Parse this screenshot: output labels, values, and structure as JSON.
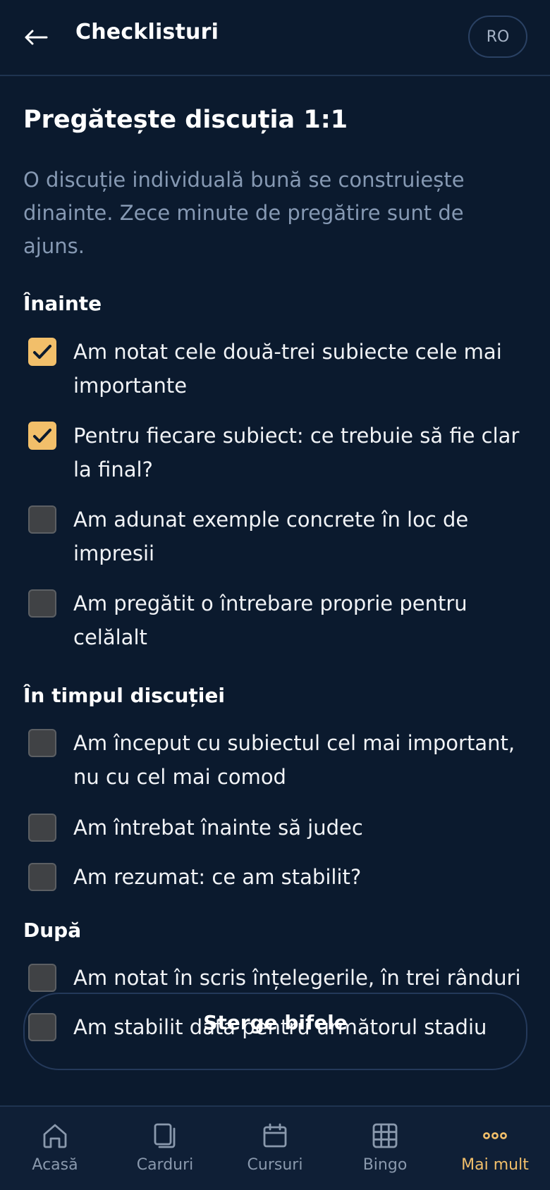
{
  "header": {
    "title": "Checklisturi",
    "lang": "RO"
  },
  "page": {
    "title": "Pregătește discuția 1:1",
    "description": "O discuție individuală bună se construiește dinainte. Zece minute de pregătire sunt de ajuns."
  },
  "sections": [
    {
      "title": "Înainte",
      "items": [
        {
          "label": "Am notat cele două-trei subiecte cele mai importante",
          "checked": true
        },
        {
          "label": "Pentru fiecare subiect: ce trebuie să fie clar la final?",
          "checked": true
        },
        {
          "label": "Am adunat exemple concrete în loc de impresii",
          "checked": false
        },
        {
          "label": "Am pregătit o întrebare proprie pentru celălalt",
          "checked": false
        }
      ]
    },
    {
      "title": "În timpul discuției",
      "items": [
        {
          "label": "Am început cu subiectul cel mai important, nu cu cel mai comod",
          "checked": false
        },
        {
          "label": "Am întrebat înainte să judec",
          "checked": false
        },
        {
          "label": "Am rezumat: ce am stabilit?",
          "checked": false
        }
      ]
    },
    {
      "title": "După",
      "items": [
        {
          "label": "Am notat în scris înțelegerile, în trei rânduri",
          "checked": false
        },
        {
          "label": "Am stabilit data pentru următorul stadiu",
          "checked": false
        }
      ]
    }
  ],
  "actions": {
    "clear_label": "Șterge bifele"
  },
  "nav": {
    "items": [
      {
        "label": "Acasă",
        "icon": "home-icon"
      },
      {
        "label": "Carduri",
        "icon": "cards-icon"
      },
      {
        "label": "Cursuri",
        "icon": "calendar-icon"
      },
      {
        "label": "Bingo",
        "icon": "grid-icon"
      },
      {
        "label": "Mai mult",
        "icon": "more-icon",
        "active": true
      }
    ]
  },
  "colors": {
    "background": "#0b1a2e",
    "accent": "#f2bf6a",
    "muted_text": "#8699b3"
  }
}
